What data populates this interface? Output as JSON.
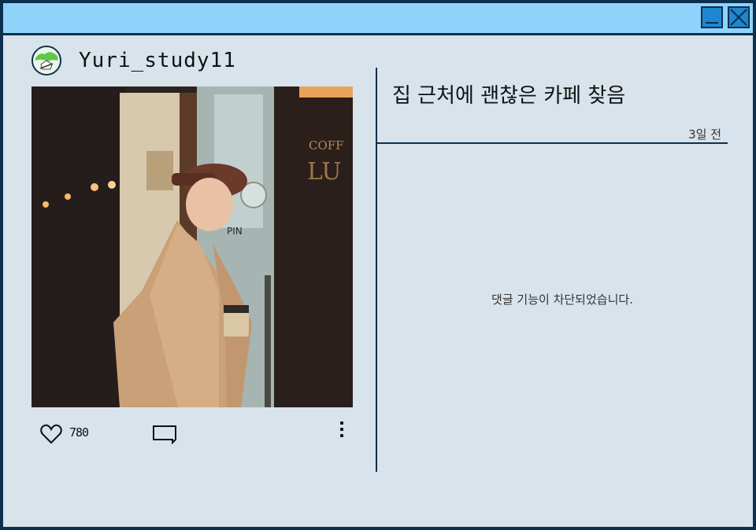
{
  "window": {
    "minimize_icon": "minimize-icon",
    "close_icon": "close-icon",
    "title_bar_color": "#8fd3fb",
    "button_color": "#1f86d0",
    "border_color": "#0d2f4f"
  },
  "post": {
    "username": "Yuri_study11",
    "avatar_icon": "avatar-icon",
    "photo": "photo of a smiling woman in a beret and beige coat holding a coffee cup outside a cafe",
    "like_count": "780",
    "title": "집 근처에 괜찮은 카페 찾음",
    "time_ago": "3일 전",
    "comment_notice": "댓글 기능이 차단되었습니다."
  }
}
